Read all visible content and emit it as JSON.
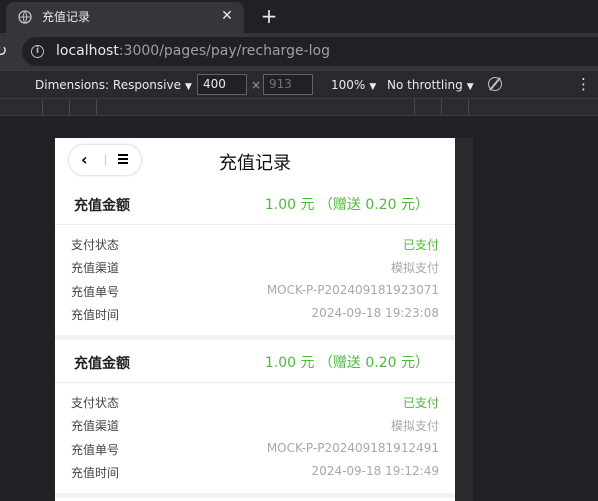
{
  "browser": {
    "tab_title": "充值记录",
    "tab_close": "✕",
    "new_tab": "+",
    "url_host": "localhost",
    "url_path": ":3000/pages/pay/recharge-log"
  },
  "devtools": {
    "dimensions_label": "Dimensions: Responsive",
    "width_value": "400",
    "times": "×",
    "height_placeholder": "913",
    "zoom": "100%",
    "throttling": "No throttling",
    "more": "⋮"
  },
  "page": {
    "title": "充值记录",
    "back_glyph": "‹",
    "records": [
      {
        "amount_label": "充值金额",
        "amount_value": "1.00 元 （赠送 0.20 元）",
        "rows": [
          {
            "label": "支付状态",
            "value": "已支付"
          },
          {
            "label": "充值渠道",
            "value": "模拟支付"
          },
          {
            "label": "充值单号",
            "value": "MOCK-P-P202409181923071"
          },
          {
            "label": "充值时间",
            "value": "2024-09-18 19:23:08"
          }
        ]
      },
      {
        "amount_label": "充值金额",
        "amount_value": "1.00 元 （赠送 0.20 元）",
        "rows": [
          {
            "label": "支付状态",
            "value": "已支付"
          },
          {
            "label": "充值渠道",
            "value": "模拟支付"
          },
          {
            "label": "充值单号",
            "value": "MOCK-P-P202409181912491"
          },
          {
            "label": "充值时间",
            "value": "2024-09-18 19:12:49"
          }
        ]
      }
    ]
  },
  "colors": {
    "accent_green": "#4fb83b",
    "muted_text": "#a8a8a8",
    "browser_bg": "#202124"
  }
}
